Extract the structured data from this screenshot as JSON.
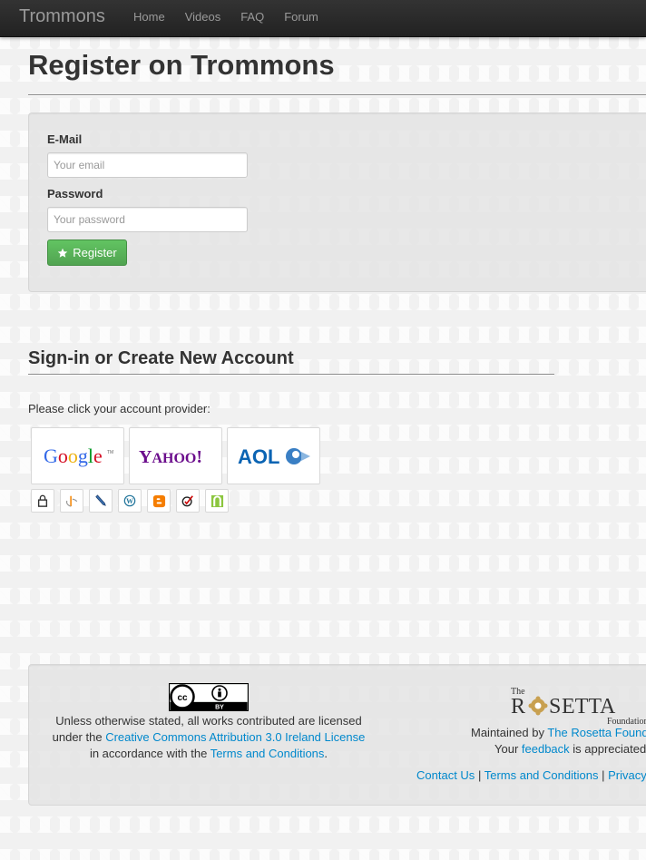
{
  "navbar": {
    "brand": "Trommons",
    "items": [
      "Home",
      "Videos",
      "FAQ",
      "Forum"
    ]
  },
  "page": {
    "title": "Register on Trommons"
  },
  "form": {
    "email_label": "E-Mail",
    "email_placeholder": "Your email",
    "email_value": "",
    "password_label": "Password",
    "password_placeholder": "Your password",
    "password_value": "",
    "register_label": "Register",
    "register_icon": "star-icon"
  },
  "signin": {
    "title": "Sign-in or Create New Account",
    "prompt": "Please click your account provider:",
    "big_providers": [
      {
        "name": "google",
        "logo_text": "Google"
      },
      {
        "name": "yahoo",
        "logo_text": "YAHOO!"
      },
      {
        "name": "aol",
        "logo_text": "AOL"
      }
    ],
    "small_providers": [
      "lock-icon",
      "openid-icon",
      "pencil-icon",
      "wordpress-icon",
      "blogger-icon",
      "verisign-icon",
      "clickpass-icon"
    ]
  },
  "footer": {
    "cc_badge": "BY",
    "license_line1": "Unless otherwise stated, all works contributed are licensed",
    "license_line2_prefix": "under the ",
    "license_link": "Creative Commons Attribution 3.0 Ireland License",
    "license_line3_prefix": "in accordance with the ",
    "terms_link": "Terms and Conditions",
    "terms_suffix": ".",
    "rosetta_the": "The",
    "rosetta_name": "RSETTA",
    "rosetta_sub": "Foundation",
    "maintained_prefix": "Maintained by ",
    "maintained_link": "The Rosetta Foundation",
    "feedback_prefix": "Your ",
    "feedback_link": "feedback",
    "feedback_suffix": " is appreciated",
    "links": [
      "Contact Us",
      "Terms and Conditions",
      "Privacy"
    ],
    "separator": "|"
  },
  "colors": {
    "navbar_bg": "#222222",
    "link": "#0088cc",
    "register_button": "#5bb75b",
    "google_blue": "#3369e8",
    "google_red": "#d50f25",
    "google_yellow": "#eeb211",
    "google_green": "#009925",
    "yahoo_purple": "#6b0d8c",
    "aol_blue": "#0b64b3",
    "blogger_orange": "#f57d00"
  }
}
